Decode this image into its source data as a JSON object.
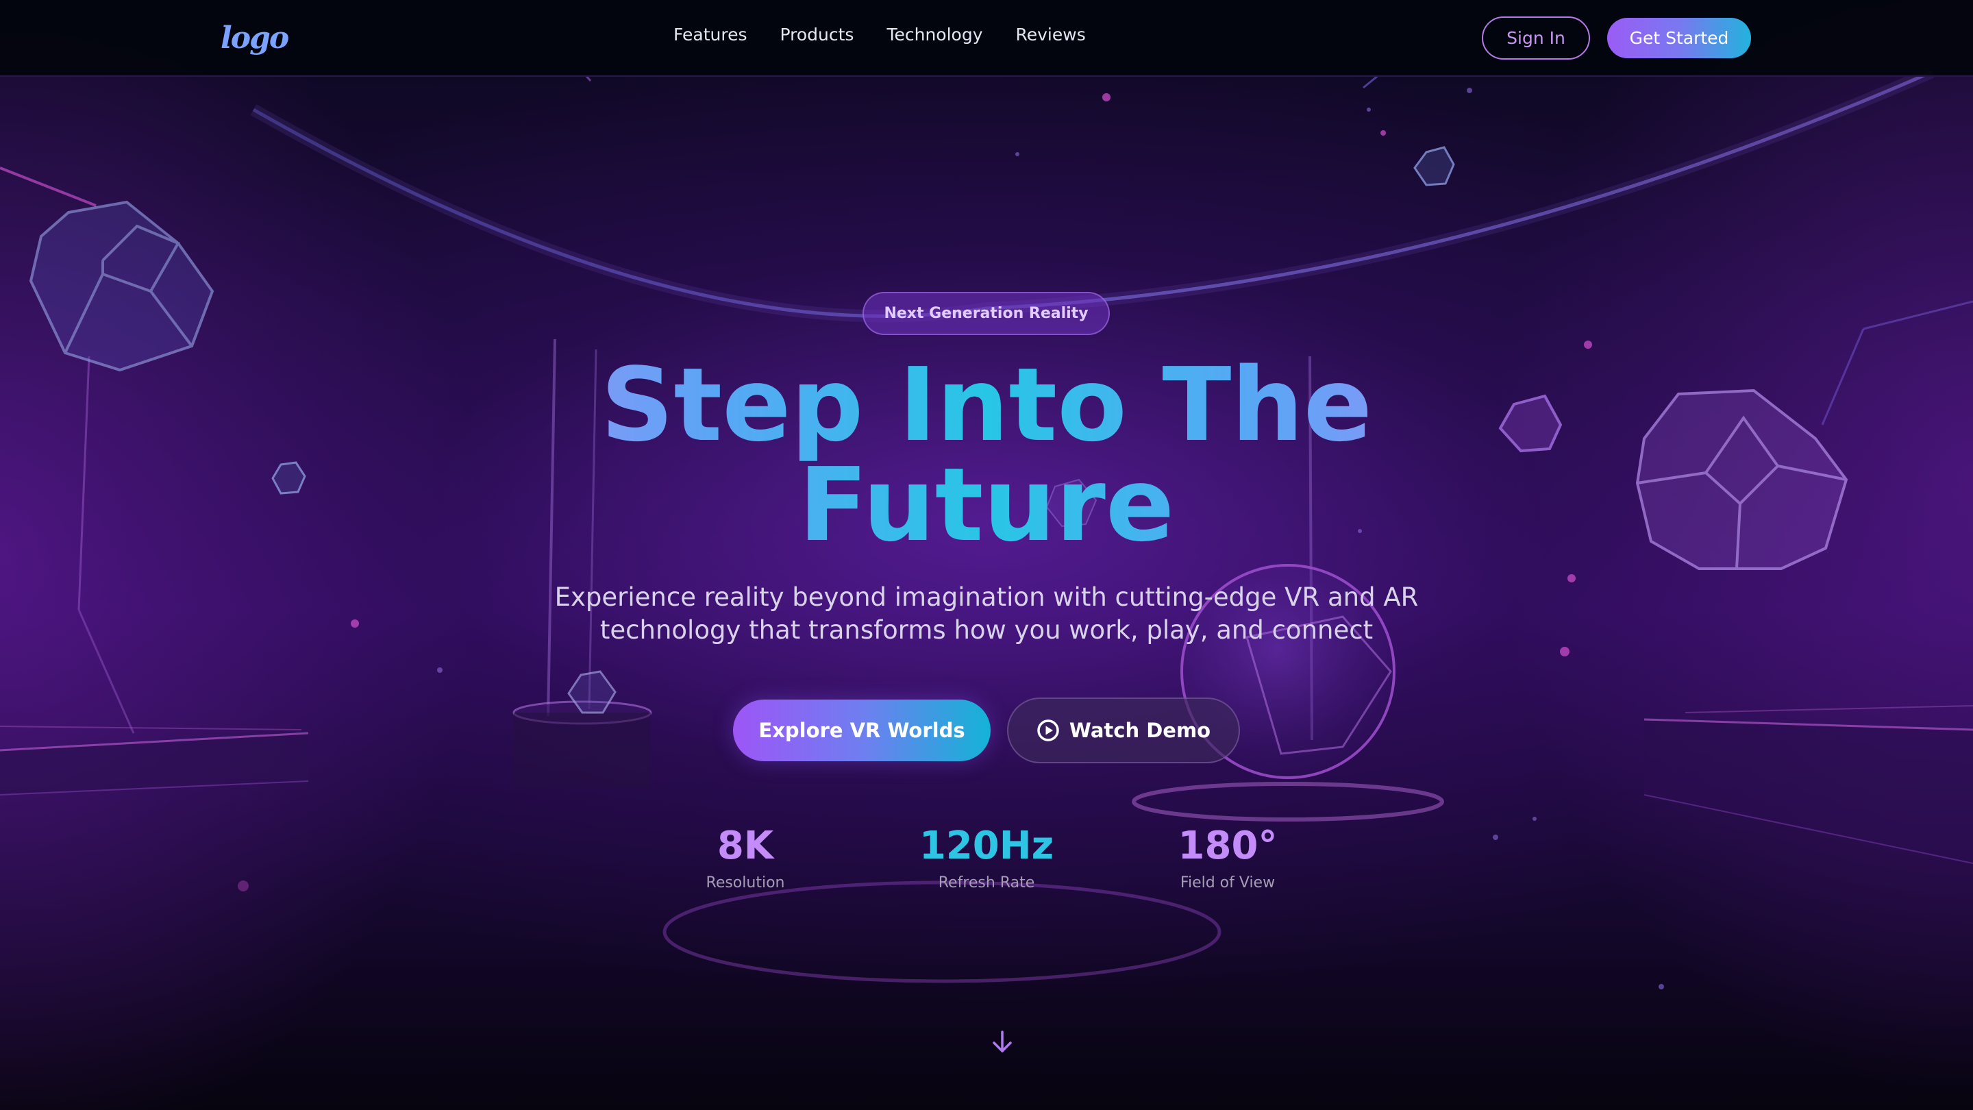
{
  "nav": {
    "logo": "logo",
    "links": [
      "Features",
      "Products",
      "Technology",
      "Reviews"
    ],
    "sign_in": "Sign In",
    "get_started": "Get Started"
  },
  "hero": {
    "badge": "Next Generation Reality",
    "title_line1": "Step Into The",
    "title_line2": "Future",
    "subtitle_line1": "Experience reality beyond imagination with cutting-edge VR and AR",
    "subtitle_line2": "technology that transforms how you work, play, and connect",
    "primary_button": "Explore VR Worlds",
    "secondary_button": "Watch Demo",
    "secondary_button_icon": "play-circle-icon"
  },
  "stats": [
    {
      "value": "8K",
      "label": "Resolution",
      "color": "#c48cf8"
    },
    {
      "value": "120Hz",
      "label": "Refresh Rate",
      "color": "#2ec4e4"
    },
    {
      "value": "180°",
      "label": "Field of View",
      "color": "#c48cf8"
    }
  ],
  "scroll_icon": "arrow-down-icon",
  "colors": {
    "accent_purple": "#9a5cf5",
    "accent_cyan": "#22b3dc",
    "background": "#0a0618"
  }
}
